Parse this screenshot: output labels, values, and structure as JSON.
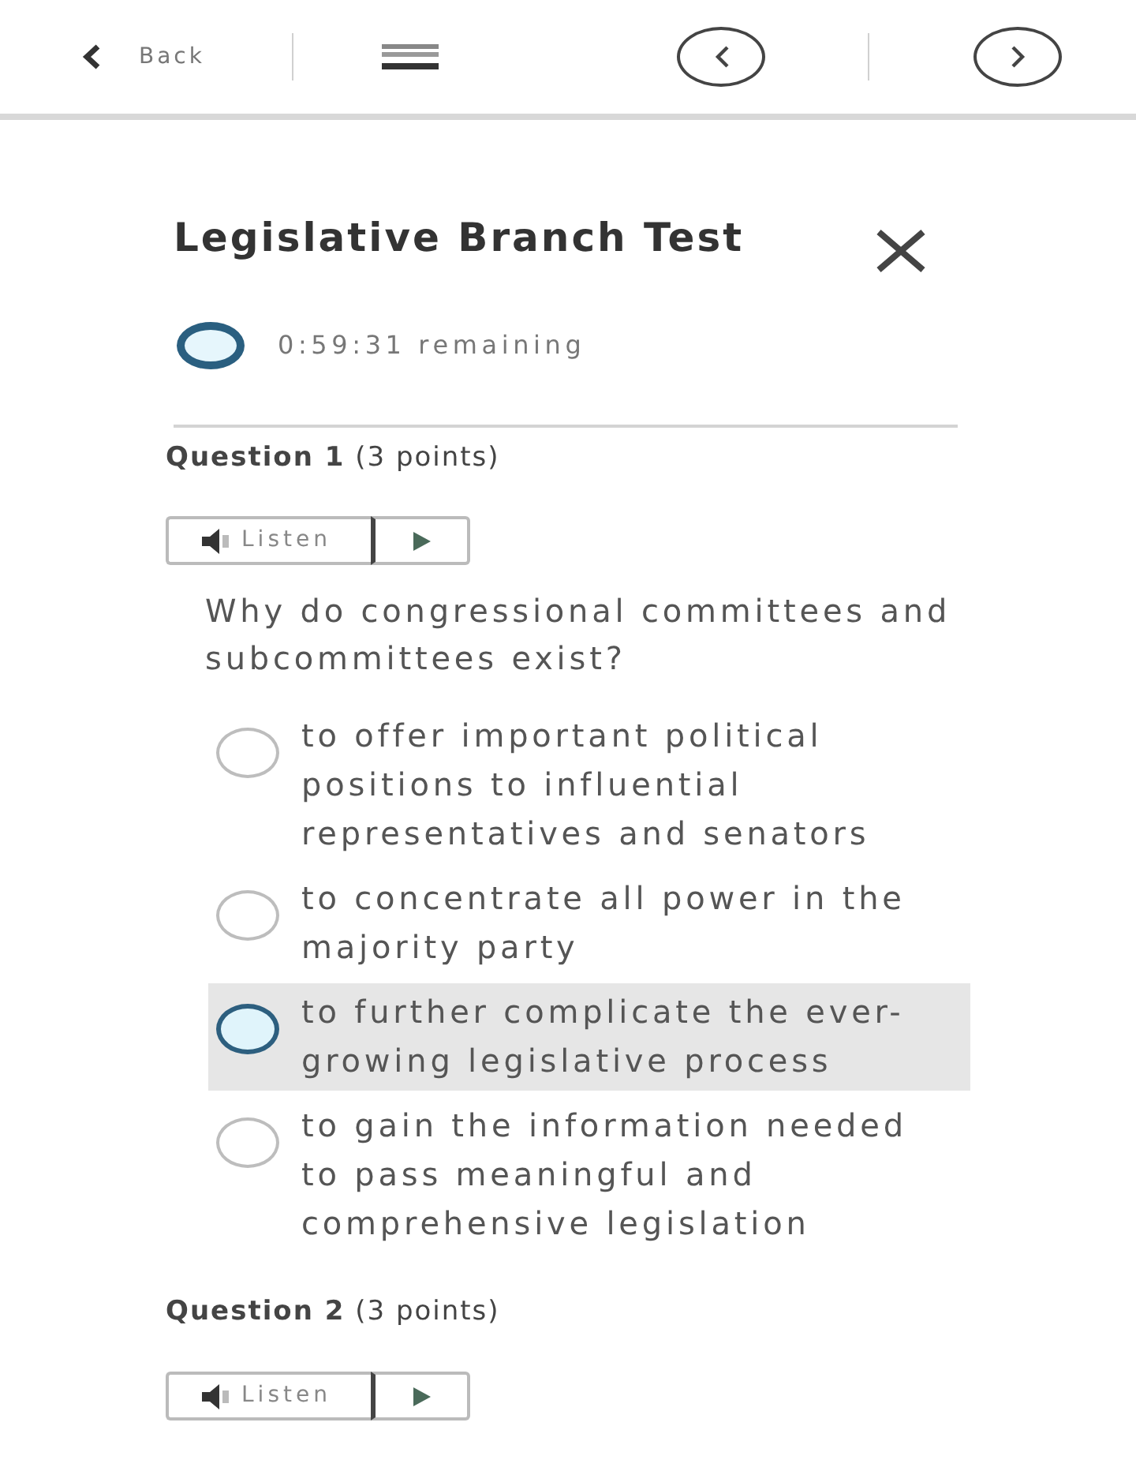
{
  "toolbar": {
    "back_label": "Back"
  },
  "test": {
    "title": "Legislative Branch Test",
    "timer": "0:59:31 remaining"
  },
  "questions": [
    {
      "heading": "**Question 1** (3 points)",
      "listen_label": "Listen",
      "prompt": "Why do congressional committees and subcommittees exist?",
      "options": [
        {
          "text": "to offer important political positions to influential representatives and senators",
          "selected": false
        },
        {
          "text": "to concentrate all power in the majority party",
          "selected": false
        },
        {
          "text": "to further complicate the ever-growing legislative process",
          "selected": true
        },
        {
          "text": "to gain the information needed to pass meaningful and comprehensive legislation",
          "selected": false
        }
      ]
    },
    {
      "heading": "**Question 2** (3 points)",
      "listen_label": "Listen"
    }
  ]
}
